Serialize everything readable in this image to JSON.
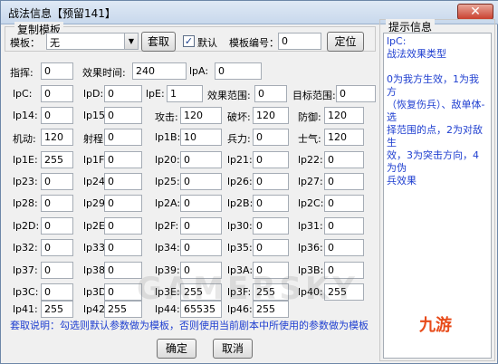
{
  "window": {
    "title": "战法信息【预留141】",
    "close_glyph": "✕"
  },
  "copy_template": {
    "group_title": "复制模板",
    "template_label": "模板：",
    "template_value": "无",
    "fetch_button": "套取",
    "default_label": "默认",
    "default_checked": true,
    "template_id_label": "模板编号：",
    "template_id_value": "0",
    "locate_button": "定位"
  },
  "fields": [
    {
      "label": "指挥:",
      "value": "0"
    },
    {
      "label": "效果时间:",
      "value": "240"
    },
    {
      "label": "lpA:",
      "value": "0"
    },
    {
      "label": "lpC:",
      "value": "0"
    },
    {
      "label": "lpD:",
      "value": "0"
    },
    {
      "label": "lpE:",
      "value": "1"
    },
    {
      "label": "效果范围:",
      "value": "0"
    },
    {
      "label": "目标范围:",
      "value": "0"
    },
    {
      "label": "lp14:",
      "value": "0"
    },
    {
      "label": "lp15:",
      "value": "0"
    },
    {
      "label": "攻击:",
      "value": "120"
    },
    {
      "label": "破坏:",
      "value": "120"
    },
    {
      "label": "防御:",
      "value": "120"
    },
    {
      "label": "机动:",
      "value": "120"
    },
    {
      "label": "射程:",
      "value": "0"
    },
    {
      "label": "lp1B:",
      "value": "10"
    },
    {
      "label": "兵力:",
      "value": "0"
    },
    {
      "label": "士气:",
      "value": "120"
    },
    {
      "label": "lp1E:",
      "value": "255"
    },
    {
      "label": "lp1F:",
      "value": "0"
    },
    {
      "label": "lp20:",
      "value": "0"
    },
    {
      "label": "lp21:",
      "value": "0"
    },
    {
      "label": "lp22:",
      "value": "0"
    },
    {
      "label": "lp23:",
      "value": "0"
    },
    {
      "label": "lp24:",
      "value": "0"
    },
    {
      "label": "lp25:",
      "value": "0"
    },
    {
      "label": "lp26:",
      "value": "0"
    },
    {
      "label": "lp27:",
      "value": "0"
    },
    {
      "label": "lp28:",
      "value": "0"
    },
    {
      "label": "lp29:",
      "value": "0"
    },
    {
      "label": "lp2A:",
      "value": "0"
    },
    {
      "label": "lp2B:",
      "value": "0"
    },
    {
      "label": "lp2C:",
      "value": "0"
    },
    {
      "label": "lp2D:",
      "value": "0"
    },
    {
      "label": "lp2E:",
      "value": "0"
    },
    {
      "label": "lp2F:",
      "value": "0"
    },
    {
      "label": "lp30:",
      "value": "0"
    },
    {
      "label": "lp31:",
      "value": "0"
    },
    {
      "label": "lp32:",
      "value": "0"
    },
    {
      "label": "lp33:",
      "value": "0"
    },
    {
      "label": "lp34:",
      "value": "0"
    },
    {
      "label": "lp35:",
      "value": "0"
    },
    {
      "label": "lp36:",
      "value": "0"
    },
    {
      "label": "lp37:",
      "value": "0"
    },
    {
      "label": "lp38:",
      "value": "0"
    },
    {
      "label": "lp39:",
      "value": "0"
    },
    {
      "label": "lp3A:",
      "value": "0"
    },
    {
      "label": "lp3B:",
      "value": "0"
    },
    {
      "label": "lp3C:",
      "value": "0"
    },
    {
      "label": "lp3D:",
      "value": "0"
    },
    {
      "label": "lp3E:",
      "value": "255"
    },
    {
      "label": "lp3F:",
      "value": "255"
    },
    {
      "label": "lp40:",
      "value": "255"
    },
    {
      "label": "lp41:",
      "value": "255"
    },
    {
      "label": "lp42:",
      "value": "255"
    },
    {
      "label": "lp44:",
      "value": "65535"
    },
    {
      "label": "lp46:",
      "value": "255"
    }
  ],
  "note": "套取说明：勾选则默认参数做为模板，否则使用当前剧本中所使用的参数做为模板",
  "ok_button": "确定",
  "cancel_button": "取消",
  "hint": {
    "title": "提示信息",
    "lines": [
      "lpC:",
      "战法效果类型",
      "",
      "0为我方生效，1为我方",
      "（恢复伤兵）、敌单体-选",
      "择范围的点，2为对敌生",
      "效，3为突击方向，4为伪",
      "兵效果"
    ]
  },
  "watermark": "GAMERSKY",
  "logo_text": "九游"
}
